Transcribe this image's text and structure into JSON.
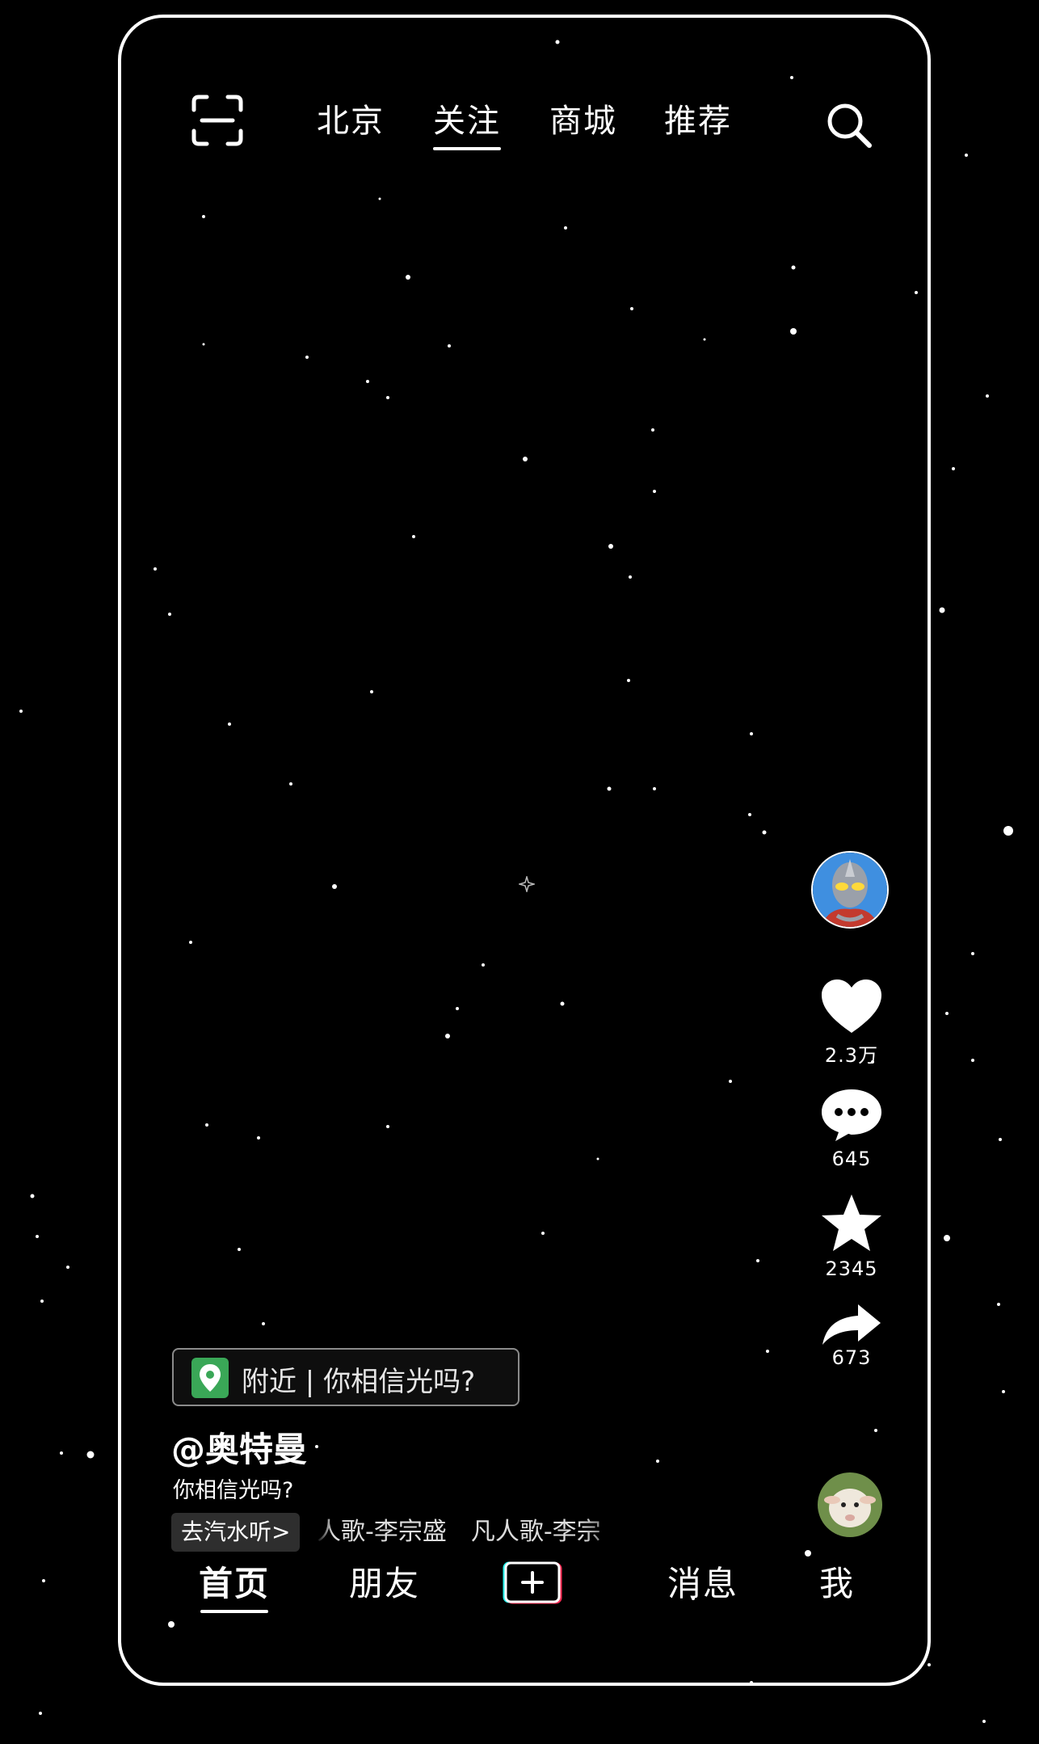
{
  "top_nav": {
    "tabs": [
      {
        "label": "北京"
      },
      {
        "label": "关注",
        "active": true
      },
      {
        "label": "商城"
      },
      {
        "label": "推荐"
      }
    ]
  },
  "actions": {
    "like_count": "2.3万",
    "comment_count": "645",
    "favorite_count": "2345",
    "share_count": "673"
  },
  "post": {
    "location_tag": "附近 | 你相信光吗?",
    "author": "@奥特曼",
    "caption": "你相信光吗?",
    "music_button": "去汽水听>",
    "music_track": "人歌-李宗盛　凡人歌-李宗"
  },
  "bottom_nav": {
    "home": "首页",
    "friends": "朋友",
    "messages": "消息",
    "me": "我"
  },
  "icons": {
    "scan": "scan-icon",
    "search": "search-icon",
    "like": "heart-icon",
    "comment": "comment-icon",
    "favorite": "star-icon",
    "share": "share-icon",
    "location": "location-pin-icon",
    "create": "plus-icon"
  },
  "colors": {
    "background": "#000000",
    "foreground": "#ffffff",
    "location_pin": "#3aa757",
    "create_cyan": "#25f4ee",
    "create_red": "#fe2c55"
  }
}
